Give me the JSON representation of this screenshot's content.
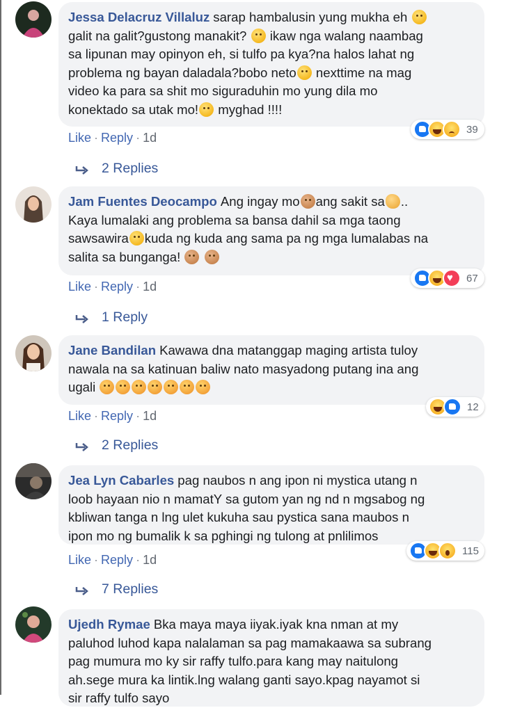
{
  "comments": [
    {
      "author": "Jessa Delacruz Villaluz",
      "lines": [
        [
          "sarap hambalusin yung mukha eh ",
          {
            "emoji": "joy"
          }
        ],
        [
          "galit na galit?gustong manakit? ",
          {
            "emoji": "laugh"
          },
          " ikaw nga walang naambag"
        ],
        [
          "sa lipunan may opinyon eh, si tulfo pa kya?na halos lahat ng"
        ],
        [
          "problema ng bayan daladala?bobo neto",
          {
            "emoji": "eyeroll"
          },
          " nexttime na mag"
        ],
        [
          "video ka para sa shit mo siguraduhin mo yung dila mo"
        ],
        [
          "konektado sa utak mo!",
          {
            "emoji": "unamused"
          },
          " myghad !!!!"
        ]
      ],
      "like": "Like",
      "reply": "Reply",
      "time": "1d",
      "reactions": [
        "like-icon",
        "haha-icon",
        "sad-icon"
      ],
      "reaction_count": "39",
      "replies_label": "2 Replies"
    },
    {
      "author": "Jam Fuentes Deocampo",
      "lines": [
        [
          "Ang ingay mo",
          {
            "emoji": "see-no-evil-monkey"
          },
          "ang sakit sa",
          {
            "emoji": "ear"
          },
          ".."
        ],
        [
          "Kaya lumalaki ang problema sa bansa dahil sa mga taong"
        ],
        [
          "sawsawira",
          {
            "emoji": "wink"
          },
          "kuda ng kuda ang sama pa ng mga lumalabas na"
        ],
        [
          "salita sa bunganga! ",
          {
            "emoji": "speak-no-evil-monkey"
          },
          " ",
          {
            "emoji": "see-no-evil-monkey"
          }
        ]
      ],
      "like": "Like",
      "reply": "Reply",
      "time": "1d",
      "reactions": [
        "like-icon",
        "haha-icon",
        "love-icon"
      ],
      "reaction_count": "67",
      "replies_label": "1 Reply"
    },
    {
      "author": "Jane Bandilan",
      "lines": [
        [
          "Kawawa dna matanggap maging artista tuloy"
        ],
        [
          "nawala na sa katinuan baliw nato masyadong putang ina ang"
        ],
        [
          "ugali ",
          {
            "emoji": "angry"
          },
          {
            "emoji": "angry"
          },
          {
            "emoji": "angry"
          },
          {
            "emoji": "angry"
          },
          {
            "emoji": "angry"
          },
          {
            "emoji": "angry"
          },
          {
            "emoji": "angry"
          }
        ]
      ],
      "like": "Like",
      "reply": "Reply",
      "time": "1d",
      "reactions": [
        "haha-icon",
        "like-icon"
      ],
      "reaction_count": "12",
      "replies_label": "2 Replies"
    },
    {
      "author": "Jea Lyn Cabarles",
      "lines": [
        [
          "pag naubos n ang ipon ni mystica utang n"
        ],
        [
          "loob hayaan nio n mamatY sa gutom yan ng nd n mgsabog ng"
        ],
        [
          "kbliwan tanga n lng ulet kukuha sau pystica sana maubos n"
        ],
        [
          "ipon mo ng bumalik k sa pghingi ng tulong at pnlilimos"
        ]
      ],
      "like": "Like",
      "reply": "Reply",
      "time": "1d",
      "reactions": [
        "like-icon",
        "haha-icon",
        "wow-icon"
      ],
      "reaction_count": "115",
      "replies_label": "7 Replies"
    },
    {
      "author": "Ujedh Rymae",
      "lines": [
        [
          "Bka maya maya iiyak.iyak kna nman at my"
        ],
        [
          "paluhod luhod kapa nalalaman sa pag mamakaawa sa subrang"
        ],
        [
          "pag mumura mo ky sir raffy tulfo.para kang may naitulong"
        ],
        [
          "ah.sege mura ka lintik.lng walang ganti sayo.kpag nayamot si"
        ],
        [
          "sir raffy tulfo sayo"
        ]
      ]
    }
  ],
  "colors": {
    "link": "#385898",
    "bubble": "#f2f3f5",
    "meta": "#616770",
    "text": "#1c1e21"
  }
}
